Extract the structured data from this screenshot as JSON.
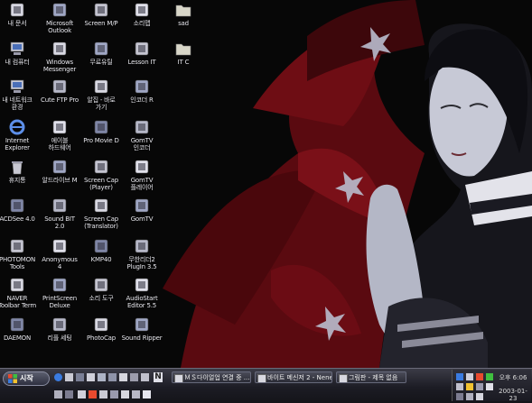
{
  "desktop": {
    "icons": [
      {
        "label": "내 문서",
        "icon": "my-documents-icon"
      },
      {
        "label": "Microsoft\nOutlook",
        "icon": "outlook-icon"
      },
      {
        "label": "Screen M/P",
        "icon": "screen-capture-icon"
      },
      {
        "label": "소리맵",
        "icon": "sound-map-icon"
      },
      {
        "label": "sad",
        "icon": "folder-icon"
      },
      {
        "label": "내 컴퓨터",
        "icon": "my-computer-icon"
      },
      {
        "label": "Windows\nMessenger",
        "icon": "messenger-icon"
      },
      {
        "label": "무료유틸",
        "icon": "free-utility-icon"
      },
      {
        "label": "Lesson IT",
        "icon": "lesson-icon"
      },
      {
        "label": "IT C",
        "icon": "folder-icon"
      },
      {
        "label": "내 네트워크\n환경",
        "icon": "network-places-icon"
      },
      {
        "label": "Cute FTP Pro",
        "icon": "cuteftp-icon"
      },
      {
        "label": "알집 - 바로\n가기",
        "icon": "alzip-icon"
      },
      {
        "label": "인코더 R",
        "icon": "encoder-icon"
      },
      {
        "label": "Internet\nExplorer",
        "icon": "internet-explorer-icon"
      },
      {
        "label": "에이블\n하드웨어",
        "icon": "able-hardware-icon"
      },
      {
        "label": "Pro Movie D",
        "icon": "movie-icon"
      },
      {
        "label": "GomTV\n인코더",
        "icon": "gomtv-encoder-icon"
      },
      {
        "label": "휴지통",
        "icon": "recycle-bin-icon"
      },
      {
        "label": "알드라이브 M",
        "icon": "aldrive-icon"
      },
      {
        "label": "Screen Cap\n(Player)",
        "icon": "screencap-player-icon"
      },
      {
        "label": "GomTV\n플레이어",
        "icon": "gomtv-player-icon"
      },
      {
        "label": "ACDSee 4.0",
        "icon": "acdsee-icon"
      },
      {
        "label": "Sound BIT\n2.0",
        "icon": "soundbit-icon"
      },
      {
        "label": "Screen Cap\n(Translator)",
        "icon": "screencap-translator-icon"
      },
      {
        "label": "GomTV",
        "icon": "gomtv-icon"
      },
      {
        "label": "PHOTOMON\nTools",
        "icon": "photomon-tools-icon"
      },
      {
        "label": "Anonymous\n4",
        "icon": "anonymous-icon"
      },
      {
        "label": "KMP40",
        "icon": "kmplayer-icon"
      },
      {
        "label": "무한리더2\nPlugIn 3.5",
        "icon": "reader-plugin-icon"
      },
      {
        "label": "NAVER\nToolbar Term",
        "icon": "naver-toolbar-icon"
      },
      {
        "label": "PrintScreen\nDeluxe",
        "icon": "printscreen-icon"
      },
      {
        "label": "소리 도구",
        "icon": "sound-tool-icon"
      },
      {
        "label": "AudioStart\nEditor 5.5",
        "icon": "audio-editor-icon"
      },
      {
        "label": "DAEMON",
        "icon": "daemon-tools-icon"
      },
      {
        "label": "리플 세팅",
        "icon": "ripple-setting-icon"
      },
      {
        "label": "PhotoCap",
        "icon": "photocap-icon"
      },
      {
        "label": "Sound Ripper",
        "icon": "sound-ripper-icon"
      }
    ]
  },
  "taskbar": {
    "start_label": "시작",
    "tasks": [
      {
        "label": "ＭＳ다이얼업 연결 중 ..."
      },
      {
        "label": "바이트 메신저 2 - Nene..."
      },
      {
        "label": "그림판 - 제목 없음"
      }
    ],
    "clock_time": "오후 6:06",
    "clock_date": "2003-01-23"
  },
  "colors": {
    "taskbar": "#1c1c24",
    "wallpaper_red": "#6a0d12",
    "icon_text": "#e8e8ee"
  }
}
